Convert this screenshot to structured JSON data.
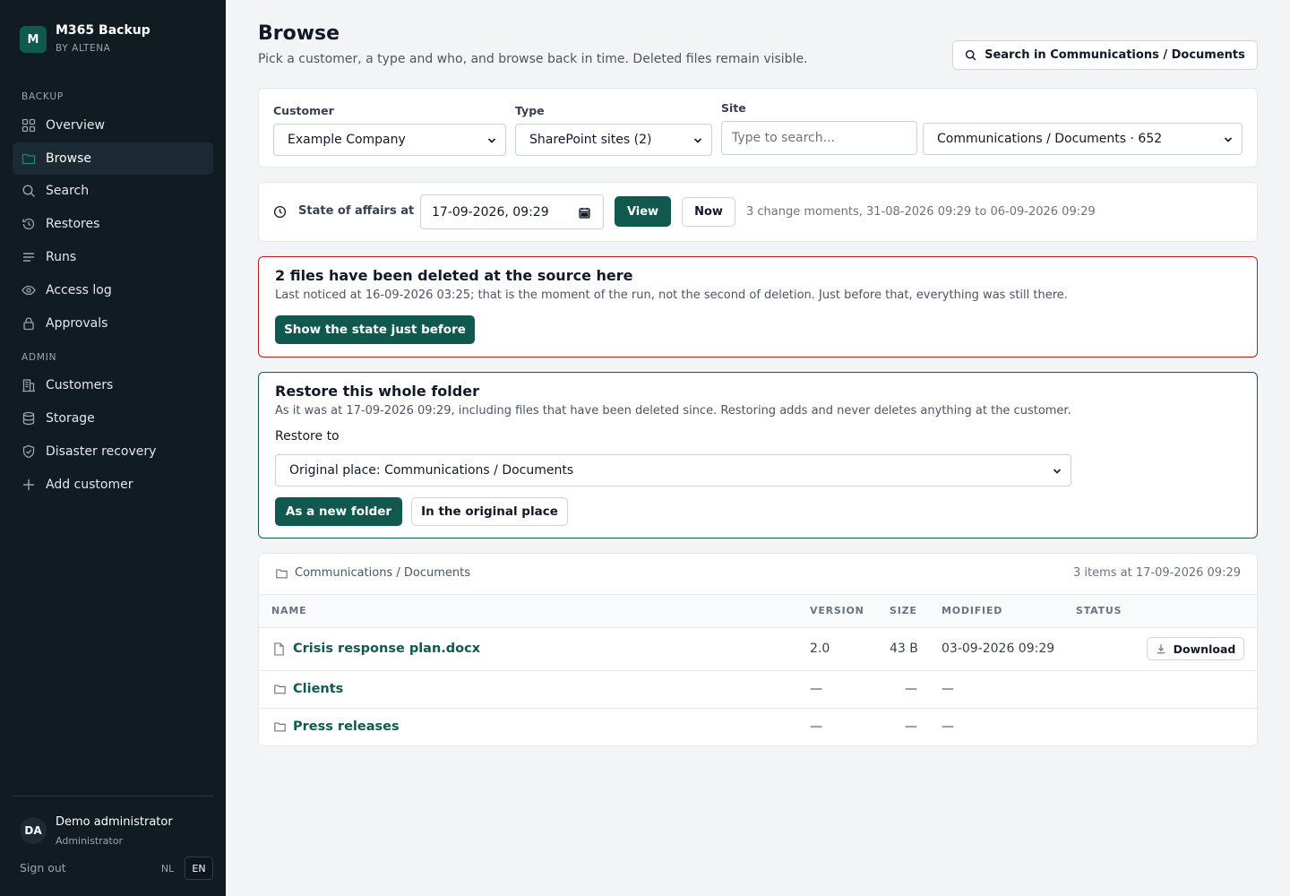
{
  "app": {
    "logo_letter": "M",
    "title": "M365 Backup",
    "subtitle": "BY ALTENA"
  },
  "sidebar": {
    "section_backup": "BACKUP",
    "section_admin": "ADMIN",
    "items": [
      {
        "label": "Overview",
        "icon": "grid-icon"
      },
      {
        "label": "Browse",
        "icon": "folder-icon",
        "active": true
      },
      {
        "label": "Search",
        "icon": "search-icon"
      },
      {
        "label": "Restores",
        "icon": "history-icon"
      },
      {
        "label": "Runs",
        "icon": "list-icon"
      },
      {
        "label": "Access log",
        "icon": "eye-icon"
      },
      {
        "label": "Approvals",
        "icon": "lock-icon"
      },
      {
        "label": "Customers",
        "icon": "building-icon"
      },
      {
        "label": "Storage",
        "icon": "database-icon"
      },
      {
        "label": "Disaster recovery",
        "icon": "shield-icon"
      },
      {
        "label": "Add customer",
        "icon": "plus-icon"
      }
    ],
    "user": {
      "initials": "DA",
      "name": "Demo administrator",
      "role": "Administrator"
    },
    "sign_out": "Sign out",
    "languages": [
      "NL",
      "EN"
    ],
    "active_language": "EN"
  },
  "header": {
    "title": "Browse",
    "subtitle": "Pick a customer, a type and who, and browse back in time. Deleted files remain visible.",
    "search_button": "Search in Communications / Documents"
  },
  "filters": {
    "customer_label": "Customer",
    "customer_value": "Example Company",
    "type_label": "Type",
    "type_value": "SharePoint sites (2)",
    "site_label": "Site",
    "site_placeholder": "Type to search...",
    "site_value": "Communications / Documents · 652"
  },
  "timeline": {
    "label": "State of affairs at",
    "datetime": "17-09-2026, 09:29",
    "view_button": "View",
    "now_button": "Now",
    "info": "3 change moments, 31-08-2026 09:29 to 06-09-2026 09:29"
  },
  "deleted_alert": {
    "title": "2 files have been deleted at the source here",
    "text": "Last noticed at 16-09-2026 03:25; that is the moment of the run, not the second of deletion. Just before that, everything was still there.",
    "button": "Show the state just before",
    "border_color": "#b91c1c"
  },
  "restore": {
    "title": "Restore this whole folder",
    "text": "As it was at 17-09-2026 09:29, including files that have been deleted since. Restoring adds and never deletes anything at the customer.",
    "restore_to_label": "Restore to",
    "destination": "Original place: Communications / Documents",
    "new_folder_button": "As a new folder",
    "original_place_button": "In the original place"
  },
  "listing": {
    "path": "Communications / Documents",
    "summary": "3 items at 17-09-2026 09:29",
    "columns": [
      "NAME",
      "VERSION",
      "SIZE",
      "MODIFIED",
      "STATUS"
    ],
    "rows": [
      {
        "type": "file",
        "icon": "file-icon",
        "name": "Crisis response plan.docx",
        "version": "2.0",
        "size": "43 B",
        "modified": "03-09-2026 09:29",
        "action": "Download"
      },
      {
        "type": "folder",
        "icon": "folder-icon",
        "name": "Clients",
        "version": "—",
        "size": "—",
        "modified": "—"
      },
      {
        "type": "folder",
        "icon": "folder-icon",
        "name": "Press releases",
        "version": "—",
        "size": "—",
        "modified": "—"
      }
    ]
  },
  "colors": {
    "sidebar_bg": "#111b22",
    "primary": "#11594f",
    "page_bg": "#f3f4f6",
    "danger": "#b91c1c"
  }
}
